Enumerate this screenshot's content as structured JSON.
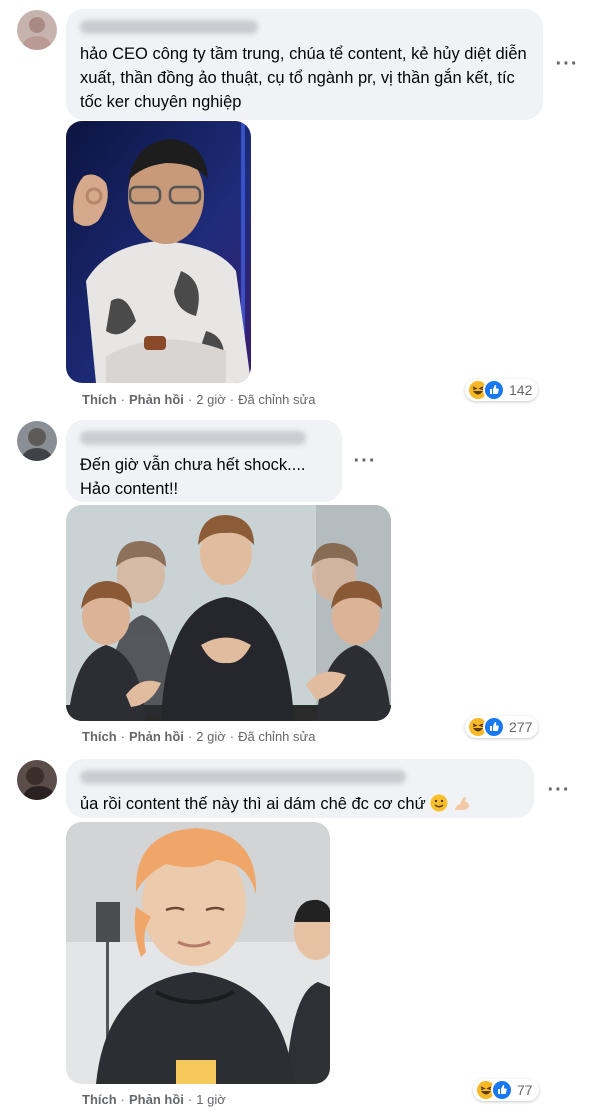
{
  "comments": [
    {
      "text": "hảo CEO công ty tầm trung, chúa tể content, kẻ hủy diệt diễn xuất, thần đồng ảo thuật, cụ tổ ngành pr, vị thần gắn kết, tíc tốc ker chuyên nghiệp",
      "like": "Thích",
      "reply": "Phản hồi",
      "time": "2 giờ",
      "edited": "Đã chỉnh sửa",
      "reaction_count": "142"
    },
    {
      "text": "Đến giờ vẫn chưa hết shock....\nHảo content!!",
      "like": "Thích",
      "reply": "Phản hồi",
      "time": "2 giờ",
      "edited": "Đã chỉnh sửa",
      "reaction_count": "277"
    },
    {
      "text": "ủa rồi content thế này thì ai dám chê đc cơ chứ",
      "like": "Thích",
      "reply": "Phản hồi",
      "time": "1 giờ",
      "reaction_count": "77"
    }
  ],
  "icons": {
    "more": "more-options-icon",
    "haha": "haha-reaction-icon",
    "like": "like-reaction-icon",
    "smile": "smile-emoji-icon",
    "arm": "flexed-arm-emoji-icon"
  },
  "colors": {
    "bubble": "#f0f2f5",
    "secondary_text": "#65676b",
    "like_blue": "#1877f2",
    "haha_yellow": "#f7b928"
  }
}
